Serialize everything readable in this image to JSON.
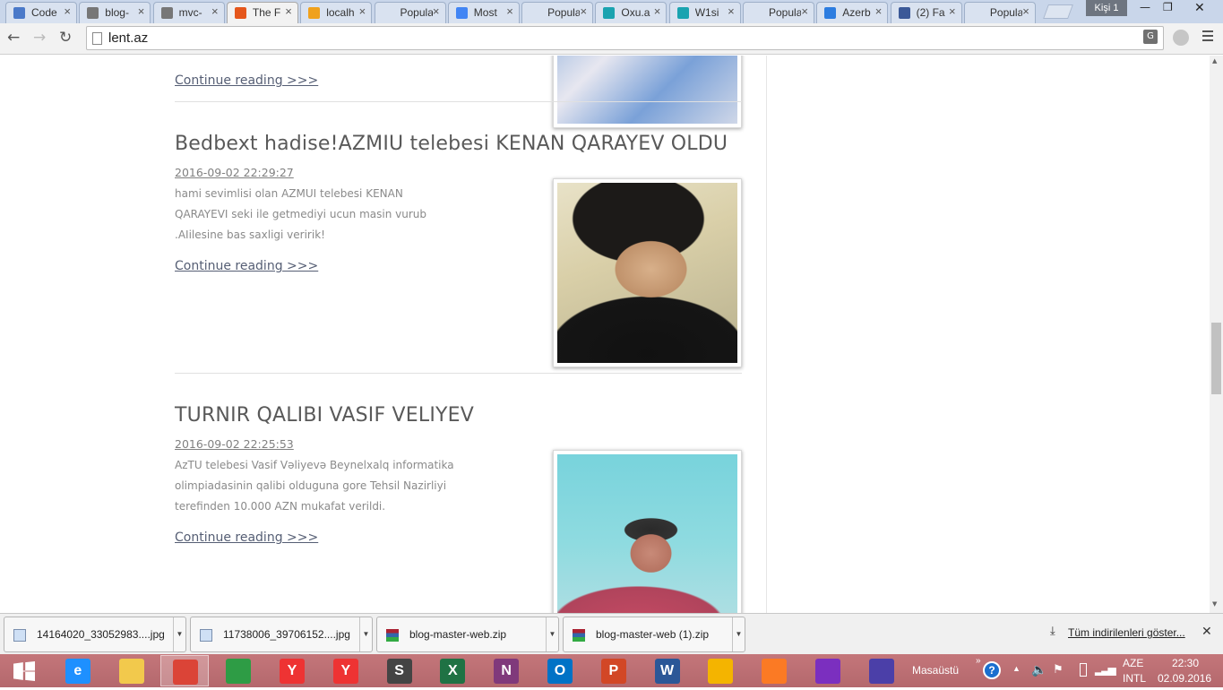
{
  "tabs": [
    {
      "title": "Code",
      "color": "#4a79c9"
    },
    {
      "title": "blog-",
      "color": "#777777"
    },
    {
      "title": "mvc-",
      "color": "#777777"
    },
    {
      "title": "The F",
      "color": "#e5571c",
      "active": true
    },
    {
      "title": "localh",
      "color": "#f0a11c"
    },
    {
      "title": "Popular",
      "color": ""
    },
    {
      "title": "Most",
      "color": "#4285f4"
    },
    {
      "title": "Popular",
      "color": ""
    },
    {
      "title": "Oxu.a",
      "color": "#1aa3b0"
    },
    {
      "title": "W1si",
      "color": "#1aa3b0"
    },
    {
      "title": "Popular",
      "color": ""
    },
    {
      "title": "Azerb",
      "color": "#2d7de0"
    },
    {
      "title": "(2) Fa",
      "color": "#3b5998"
    },
    {
      "title": "Popular",
      "color": ""
    }
  ],
  "window": {
    "user": "Kişi 1"
  },
  "address": {
    "url": "lent.az"
  },
  "posts": [
    {
      "more": "Continue reading >>>",
      "thumb_colors": [
        "#5a8fd0",
        "#e7e7f0"
      ]
    },
    {
      "title": "Bedbext hadise!AZMIU telebesi KENAN QARAYEV OLDU",
      "date": "2016-09-02 22:29:27",
      "excerpt": "hami sevimlisi olan AZMUI telebesi KENAN QARAYEVI seki ile getmediyi ucun masin vurub .AIilesine bas saxligi veririk!",
      "more": "Continue reading >>>"
    },
    {
      "title": "TURNIR QALIBI VASIF VELIYEV",
      "date": "2016-09-02 22:25:53",
      "excerpt": "AzTU telebesi Vasif Vəliyevə Beynelxalq informatika olimpiadasinin qalibi olduguna gore Tehsil Nazirliyi terefinden 10.000 AZN mukafat verildi.",
      "more": "Continue reading >>>"
    }
  ],
  "downloads": [
    {
      "name": "14164020_33052983....jpg",
      "icon": "image-file-icon"
    },
    {
      "name": "11738006_39706152....jpg",
      "icon": "image-file-icon"
    },
    {
      "name": "blog-master-web.zip",
      "icon": "zip-file-icon"
    },
    {
      "name": "blog-master-web (1).zip",
      "icon": "zip-file-icon"
    }
  ],
  "download_shelf": {
    "show_all": "Tüm indirilenleri göster..."
  },
  "taskbar": {
    "apps": [
      {
        "name": "windows-start-icon",
        "color": "#ffffff",
        "label": ""
      },
      {
        "name": "internet-explorer-icon",
        "color": "#1e90ff",
        "label": "e"
      },
      {
        "name": "file-explorer-icon",
        "color": "#f2c94c",
        "label": ""
      },
      {
        "name": "chrome-icon",
        "color": "#db4437",
        "label": "",
        "active": true
      },
      {
        "name": "store-icon",
        "color": "#2e9c45",
        "label": ""
      },
      {
        "name": "yandex-icon",
        "color": "#e33",
        "label": "Y"
      },
      {
        "name": "yandex-browser-icon",
        "color": "#e33",
        "label": "Y"
      },
      {
        "name": "sublime-text-icon",
        "color": "#444",
        "label": "S"
      },
      {
        "name": "excel-icon",
        "color": "#1f7244",
        "label": "X"
      },
      {
        "name": "onenote-icon",
        "color": "#80397b",
        "label": "N"
      },
      {
        "name": "outlook-icon",
        "color": "#0072c6",
        "label": "O"
      },
      {
        "name": "powerpoint-icon",
        "color": "#d24726",
        "label": "P"
      },
      {
        "name": "word-icon",
        "color": "#2b5797",
        "label": "W"
      },
      {
        "name": "paint-icon",
        "color": "#f4b400",
        "label": ""
      },
      {
        "name": "xampp-icon",
        "color": "#fb7a24",
        "label": ""
      },
      {
        "name": "search-app-icon",
        "color": "#7b2fbf",
        "label": ""
      },
      {
        "name": "settings-app-icon",
        "color": "#4b3fa8",
        "label": ""
      }
    ],
    "tray_label": "Masaüstü",
    "language": "AZE",
    "layout": "INTL",
    "time": "22:30",
    "date": "02.09.2016"
  }
}
